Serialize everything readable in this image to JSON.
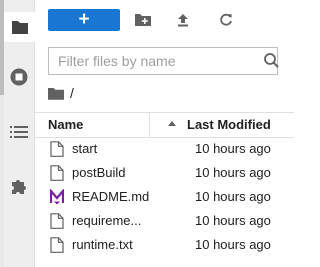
{
  "toolbar": {
    "new_launcher_label": "+",
    "new_folder_icon": "new-folder-icon",
    "upload_icon": "upload-icon",
    "refresh_icon": "refresh-icon"
  },
  "search": {
    "placeholder": "Filter files by name",
    "value": ""
  },
  "breadcrumb": {
    "separator": "/"
  },
  "listing": {
    "columns": {
      "name": "Name",
      "modified": "Last Modified"
    },
    "sort": "ascending",
    "files": [
      {
        "name": "start",
        "modified": "10 hours ago",
        "icon": "file-icon"
      },
      {
        "name": "postBuild",
        "modified": "10 hours ago",
        "icon": "file-icon"
      },
      {
        "name": "README.md",
        "modified": "10 hours ago",
        "icon": "markdown-icon"
      },
      {
        "name": "requireme...",
        "modified": "10 hours ago",
        "icon": "file-icon"
      },
      {
        "name": "runtime.txt",
        "modified": "10 hours ago",
        "icon": "file-icon"
      }
    ]
  },
  "colors": {
    "accent": "#1976d2",
    "markdown": "#7b1fa2",
    "icon": "#616161"
  }
}
